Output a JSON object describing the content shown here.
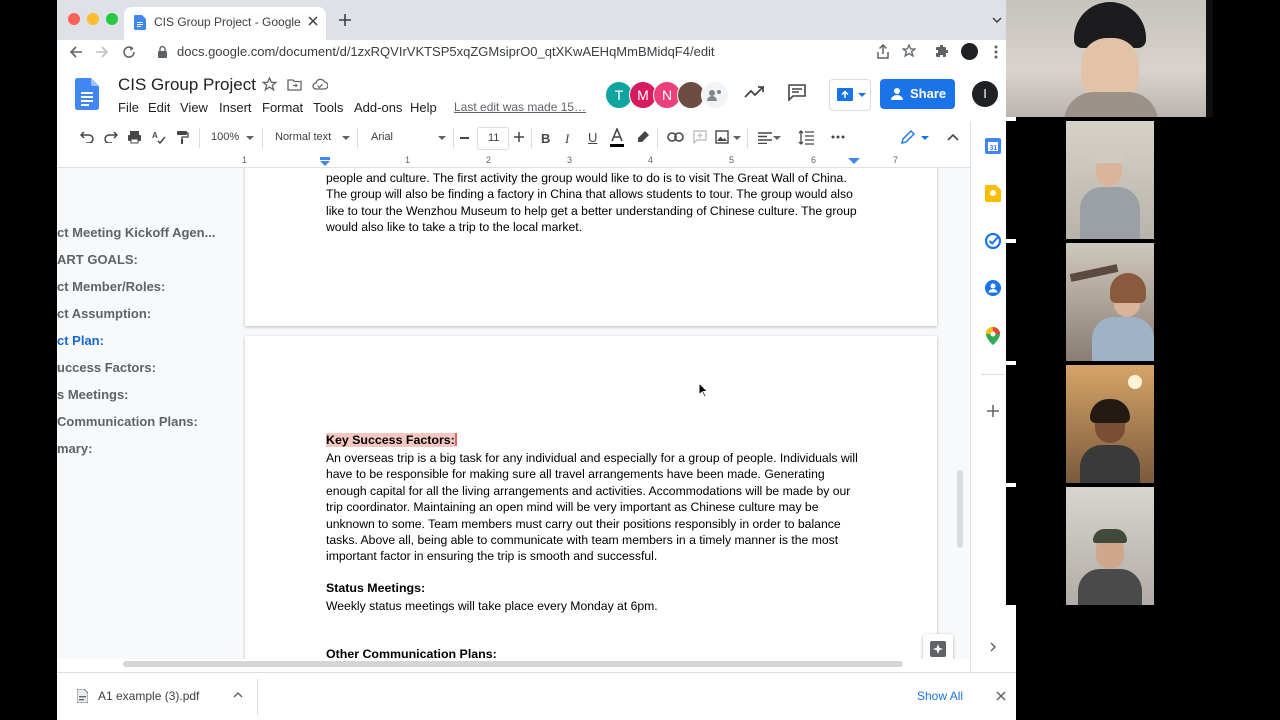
{
  "browser": {
    "tab_title": "CIS Group Project - Google Docs",
    "url": "docs.google.com/document/d/1zxRQVIrVKTSP5xqZGMsiprO0_qtXKwAEHqMmBMidqF4/edit"
  },
  "docs": {
    "title": "CIS Group Project",
    "menus": [
      "File",
      "Edit",
      "View",
      "Insert",
      "Format",
      "Tools",
      "Add-ons",
      "Help"
    ],
    "last_edit": "Last edit was made 15…",
    "collaborators": [
      {
        "initial": "T",
        "color": "#12a4a0"
      },
      {
        "initial": "M",
        "color": "#d81b60"
      },
      {
        "initial": "N",
        "color": "#ec407a"
      }
    ],
    "share_label": "Share",
    "user_initial": "I"
  },
  "toolbar": {
    "zoom": "100%",
    "style": "Normal text",
    "font": "Arial",
    "font_size": "11"
  },
  "ruler": [
    "1",
    "1",
    "2",
    "3",
    "4",
    "5",
    "6",
    "7"
  ],
  "outline": [
    "ct Meeting Kickoff Agen...",
    "ART GOALS:",
    "ct Member/Roles:",
    "ct Assumption:",
    "ct Plan:",
    "uccess Factors:",
    "s Meetings:",
    " Communication Plans:",
    "mary:"
  ],
  "page1": {
    "text": "people and culture. The first activity the group would like to do is to visit The Great Wall of China. The group will also be finding a factory in China that allows students to tour. The group would also like to tour the Wenzhou Museum to help get a better understanding of Chinese culture. The group would also like to take a trip to the local market."
  },
  "page2": {
    "ksf_heading": "Key Success Factors:",
    "ksf_text": "An overseas trip is a big task for any individual and especially for a group of people. Individuals will have to be responsible for making sure all travel arrangements have been made. Generating enough capital for all the living arrangements and activities. Accommodations will be made by our trip coordinator. Maintaining an open mind will be very important as Chinese culture may be unknown to some. Team members must carry out their positions responsibly in order to balance tasks. Above all, being able to communicate with team members in a timely manner is the most important factor in ensuring the trip is smooth and successful.",
    "status_heading": "Status Meetings:",
    "status_text": "Weekly status meetings will take place every Monday at 6pm.",
    "ocp_heading": "Other Communication Plans:"
  },
  "download": {
    "file": "A1 example (3).pdf",
    "show_all": "Show All"
  },
  "colors": {
    "brand_blue": "#1a73e8",
    "highlight": "#f4c7c3"
  }
}
